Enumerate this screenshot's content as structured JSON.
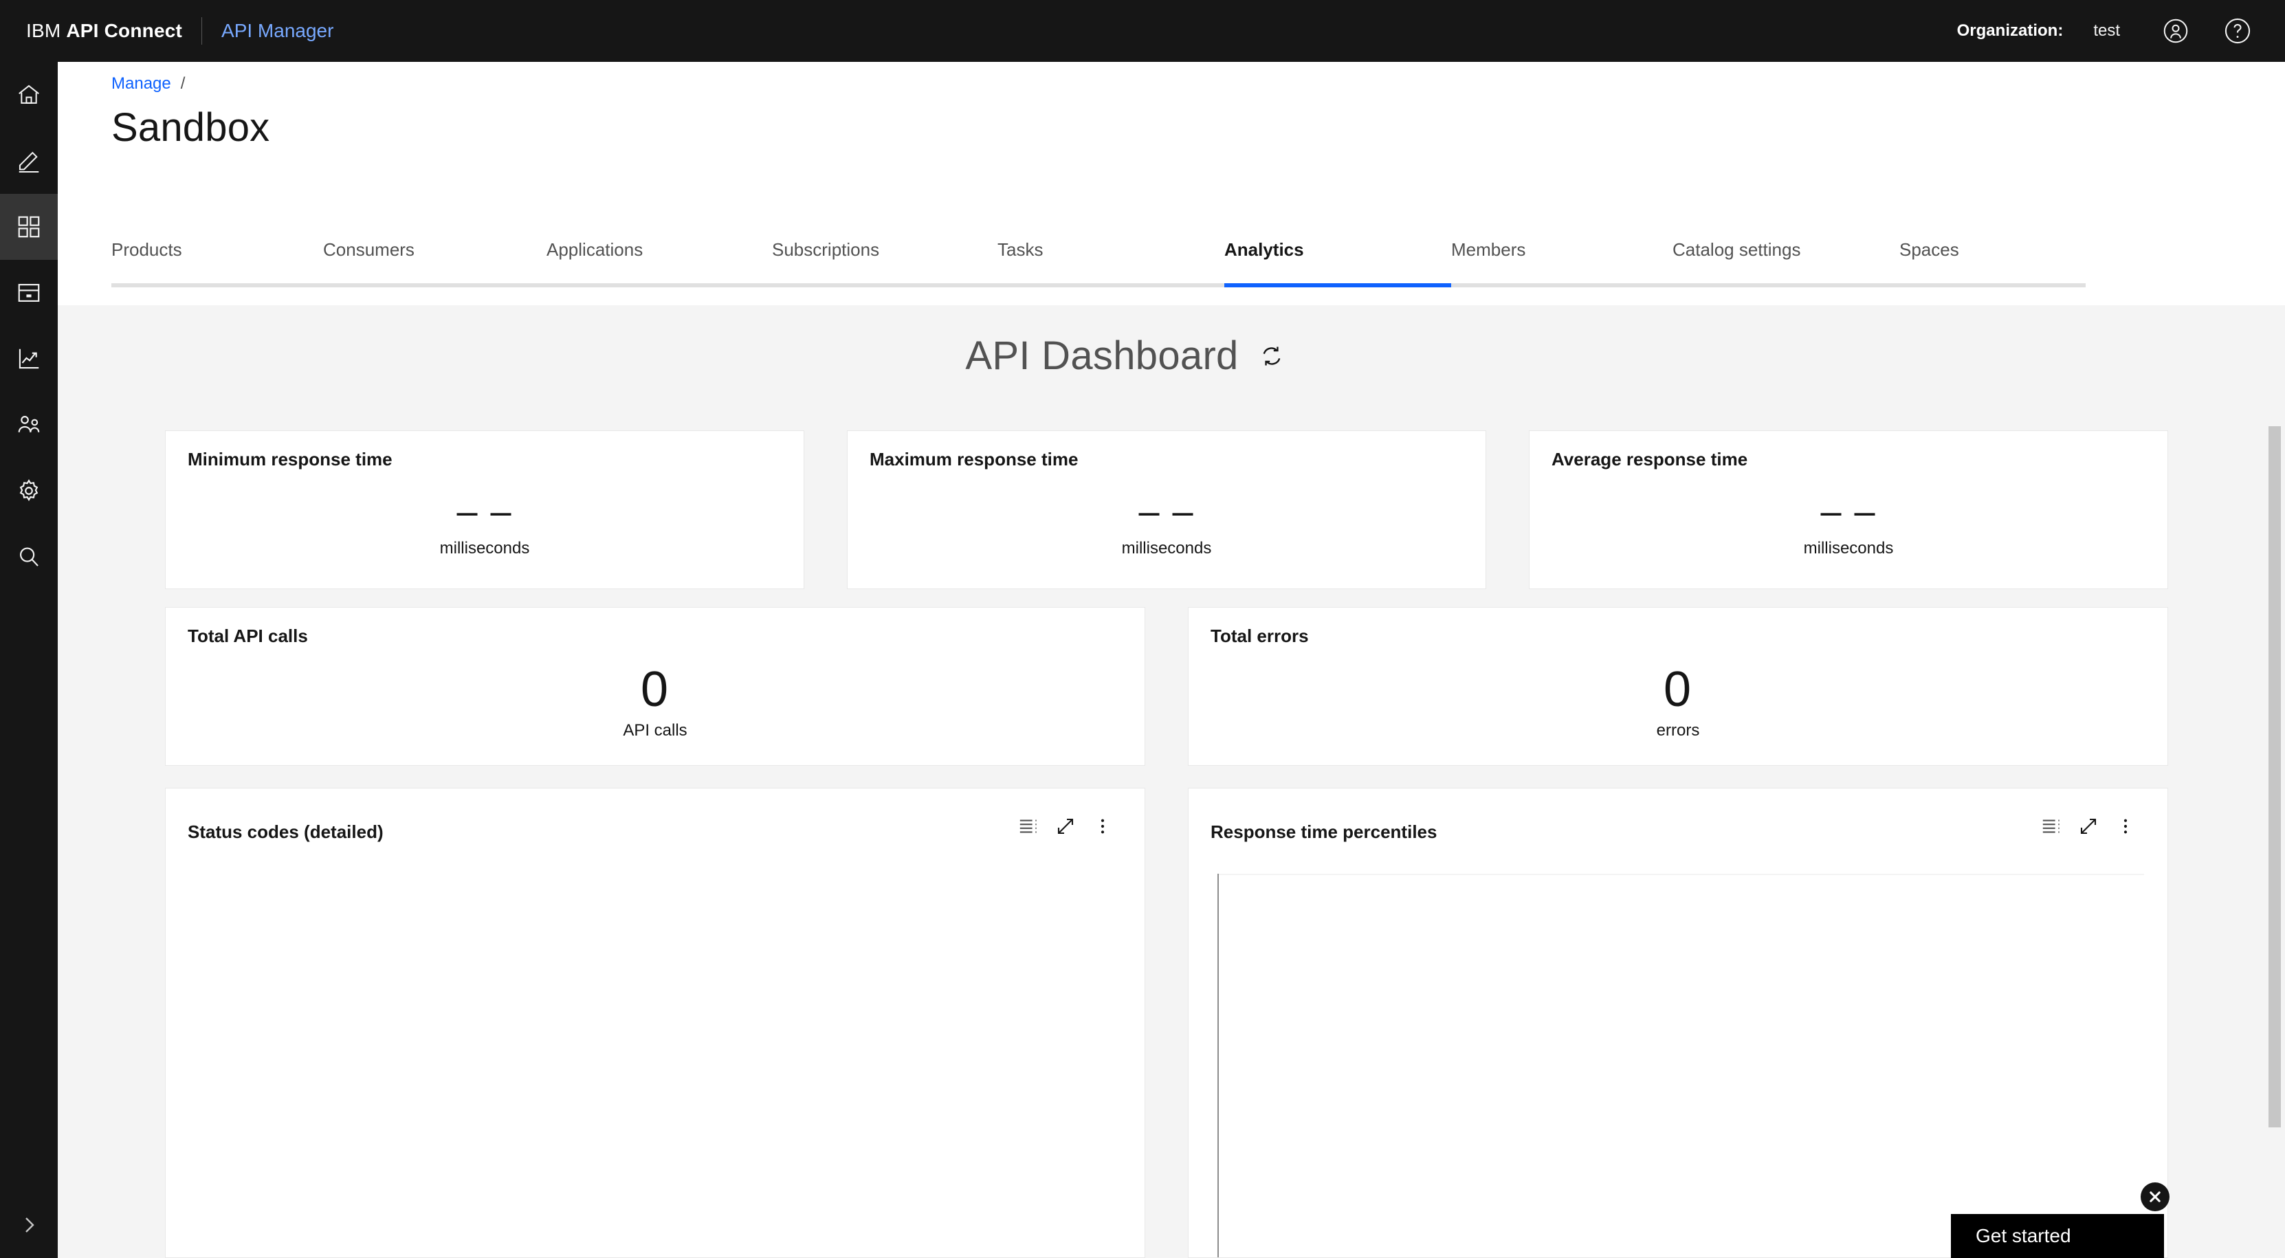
{
  "header": {
    "brand_prefix": "IBM ",
    "brand_bold": "API Connect",
    "product": "API Manager",
    "org_label": "Organization:",
    "org_value": "test",
    "account_icon": "user-avatar-icon",
    "help_icon": "help-question-icon"
  },
  "sidebar": {
    "items": [
      {
        "name": "home",
        "icon": "home-icon",
        "active": false
      },
      {
        "name": "develop",
        "icon": "pencil-edit-icon",
        "active": false
      },
      {
        "name": "manage",
        "icon": "grid-apps-icon",
        "active": true
      },
      {
        "name": "catalogs",
        "icon": "archive-catalog-icon",
        "active": false
      },
      {
        "name": "analytics",
        "icon": "chart-line-up-icon",
        "active": false
      },
      {
        "name": "members",
        "icon": "users-group-icon",
        "active": false
      },
      {
        "name": "settings",
        "icon": "gear-settings-icon",
        "active": false
      },
      {
        "name": "search",
        "icon": "magnifier-search-icon",
        "active": false
      }
    ],
    "expand_icon": "chevron-right-icon"
  },
  "breadcrumb": {
    "root": "Manage",
    "separator": "/"
  },
  "page": {
    "title": "Sandbox"
  },
  "tabs": [
    {
      "label": "Products",
      "active": false
    },
    {
      "label": "Consumers",
      "active": false
    },
    {
      "label": "Applications",
      "active": false
    },
    {
      "label": "Subscriptions",
      "active": false
    },
    {
      "label": "Tasks",
      "active": false
    },
    {
      "label": "Analytics",
      "active": true
    },
    {
      "label": "Members",
      "active": false
    },
    {
      "label": "Catalog settings",
      "active": false
    },
    {
      "label": "Spaces",
      "active": false
    }
  ],
  "dashboard": {
    "title": "API Dashboard",
    "refresh_icon": "refresh-sync-icon",
    "kpi_cards": [
      {
        "title": "Minimum response time",
        "value": "– –",
        "unit": "milliseconds"
      },
      {
        "title": "Maximum response time",
        "value": "– –",
        "unit": "milliseconds"
      },
      {
        "title": "Average response time",
        "value": "– –",
        "unit": "milliseconds"
      }
    ],
    "total_cards": [
      {
        "title": "Total API calls",
        "value": "0",
        "unit": "API calls"
      },
      {
        "title": "Total errors",
        "value": "0",
        "unit": "errors"
      }
    ],
    "chart_cards": [
      {
        "title": "Status codes (detailed)",
        "actions": [
          "list-legend-icon",
          "expand-arrows-icon",
          "overflow-menu-icon"
        ]
      },
      {
        "title": "Response time percentiles",
        "actions": [
          "list-legend-icon",
          "expand-arrows-icon",
          "overflow-menu-icon"
        ]
      }
    ]
  },
  "get_started": {
    "label": "Get started",
    "close_icon": "close-x-icon"
  },
  "colors": {
    "accent_blue": "#0f62fe",
    "link_blue": "#78a9ff",
    "header_black": "#161616",
    "page_bg": "#f4f4f4",
    "card_white": "#ffffff"
  },
  "chart_data": [
    {
      "type": "bar",
      "title": "Status codes (detailed)",
      "categories": [],
      "values": [],
      "xlabel": "",
      "ylabel": "",
      "note": "no data rendered"
    },
    {
      "type": "line",
      "title": "Response time percentiles",
      "x": [],
      "series": [],
      "xlabel": "",
      "ylabel": "",
      "note": "empty plot area, y-axis line only"
    }
  ]
}
